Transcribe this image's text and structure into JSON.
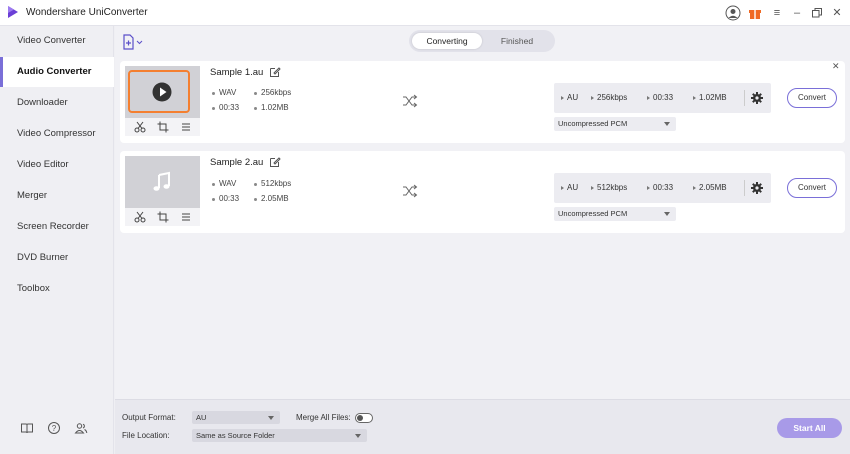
{
  "app": {
    "title": "Wondershare UniConverter"
  },
  "sidebar": {
    "items": [
      {
        "label": "Video Converter"
      },
      {
        "label": "Audio Converter"
      },
      {
        "label": "Downloader"
      },
      {
        "label": "Video Compressor"
      },
      {
        "label": "Video Editor"
      },
      {
        "label": "Merger"
      },
      {
        "label": "Screen Recorder"
      },
      {
        "label": "DVD Burner"
      },
      {
        "label": "Toolbox"
      }
    ],
    "active": "Audio Converter"
  },
  "tabs": {
    "converting": "Converting",
    "finished": "Finished"
  },
  "files": [
    {
      "name": "Sample 1.au",
      "source": {
        "format": "WAV",
        "bitrate": "256kbps",
        "duration": "00:33",
        "size": "1.02MB"
      },
      "target": {
        "format": "AU",
        "bitrate": "256kbps",
        "duration": "00:33",
        "size": "1.02MB"
      },
      "output_codec": "Uncompressed PCM",
      "convert_label": "Convert"
    },
    {
      "name": "Sample 2.au",
      "source": {
        "format": "WAV",
        "bitrate": "512kbps",
        "duration": "00:33",
        "size": "2.05MB"
      },
      "target": {
        "format": "AU",
        "bitrate": "512kbps",
        "duration": "00:33",
        "size": "2.05MB"
      },
      "output_codec": "Uncompressed PCM",
      "convert_label": "Convert"
    }
  ],
  "bottom": {
    "output_format_label": "Output Format:",
    "output_format_value": "AU",
    "merge_label": "Merge All Files:",
    "merge_enabled": false,
    "file_location_label": "File Location:",
    "file_location_value": "Same as Source Folder",
    "start_all_label": "Start All"
  },
  "colors": {
    "accent": "#7a6fd8",
    "start_button": "#a89ae8",
    "selection": "#f47f30"
  }
}
